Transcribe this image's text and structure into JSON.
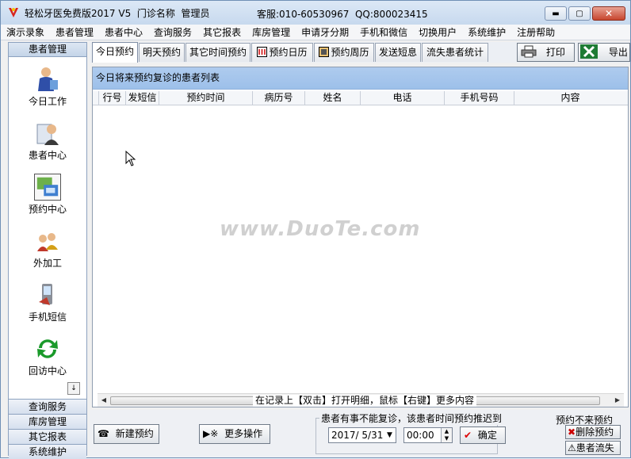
{
  "window": {
    "title": "轻松牙医免费版2017 V5  门诊名称  管理员",
    "service": "客服:010-60530967  QQ:800023415",
    "min_label": "▬",
    "max_label": "▢",
    "close_label": "✕"
  },
  "menu": [
    "演示录象",
    "患者管理",
    "患者中心",
    "查询服务",
    "其它报表",
    "库房管理",
    "申请牙分期",
    "手机和微信",
    "切换用户",
    "系统维护",
    "注册帮助"
  ],
  "sidebar": {
    "header": "患者管理",
    "items": [
      {
        "label": "今日工作",
        "icon": "doctor-icon"
      },
      {
        "label": "患者中心",
        "icon": "patient-icon"
      },
      {
        "label": "预约中心",
        "icon": "appointment-icon"
      },
      {
        "label": "外加工",
        "icon": "outsource-icon"
      },
      {
        "label": "手机短信",
        "icon": "phone-sms-icon"
      },
      {
        "label": "回访中心",
        "icon": "refresh-icon"
      }
    ],
    "scroll_label": "↓",
    "bottom": [
      "查询服务",
      "库房管理",
      "其它报表",
      "系统维护"
    ]
  },
  "tabs": [
    "今日预约",
    "明天预约",
    "其它时间预约",
    "预约日历",
    "预约周历",
    "发送短息",
    "流失患者统计"
  ],
  "toolbar": {
    "print": "打印",
    "export": "导出"
  },
  "list": {
    "caption": "今日将来预约复诊的患者列表",
    "columns": [
      "行号",
      "发短信",
      "预约时间",
      "病历号",
      "姓名",
      "电话",
      "手机号码",
      "内容"
    ],
    "hint": "在记录上【双击】打开明细，鼠标【右键】更多内容"
  },
  "watermark": "www.DuoTe.com",
  "bottom": {
    "new_appt": "新建预约",
    "more_ops": "更多操作",
    "postpone_title": "患者有事不能复诊，该患者时间预约推迟到",
    "date_value": "2017/ 5/31",
    "time_value": "00:00",
    "confirm": "确定",
    "nocome_title": "预约不来预约",
    "delete_appt": "删除预约",
    "lost_patient": "患者流失"
  },
  "colors": {
    "caption_bg": "#a6c6ec",
    "title_bg": "#cfdff1",
    "accent_green": "#1a9a2a"
  }
}
